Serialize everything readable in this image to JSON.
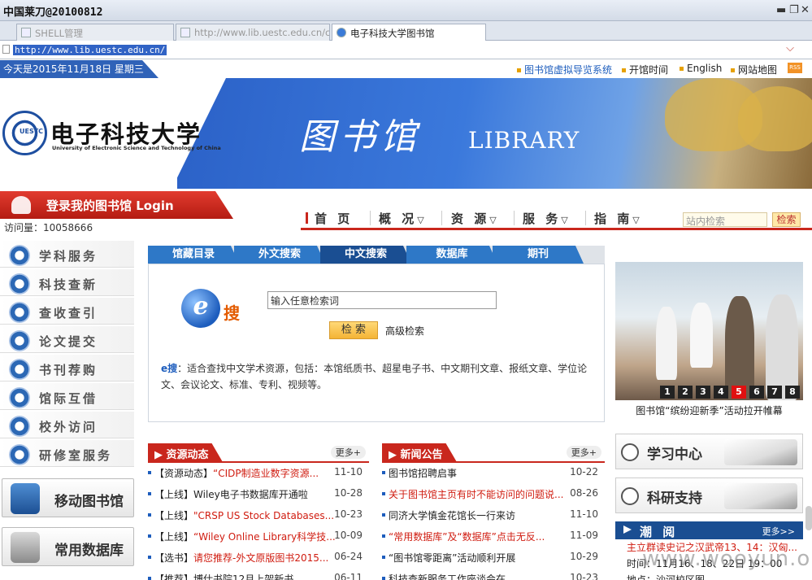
{
  "window": {
    "title": "中国莱刀@20100812",
    "min": "▬",
    "restore": "❐",
    "close": "✕"
  },
  "tabs": [
    {
      "label": "SHELL管理"
    },
    {
      "label": "http://www.lib.uestc.edu.cn/css..."
    },
    {
      "label": "电子科技大学图书馆"
    }
  ],
  "address": {
    "url": "http://www.lib.uestc.edu.cn/"
  },
  "top": {
    "date": "今天是2015年11月18日 星期三",
    "links": [
      "图书馆虚拟导览系统",
      "开馆时间",
      "English",
      "网站地图"
    ],
    "rss": "RSS"
  },
  "banner": {
    "uni_cn": "电子科技大学",
    "uni_en": "University of Electronic Science and Technology of China",
    "seal": "UESTC",
    "lib_cn": "图书馆",
    "lib_en": "LIBRARY"
  },
  "login": {
    "label": "登录我的图书馆    Login",
    "visits": "访问量：10058666"
  },
  "nav": {
    "items": [
      "首 页",
      "概 况",
      "资 源",
      "服 务",
      "指 南"
    ],
    "search_placeholder": "站内检索",
    "search_btn": "检索"
  },
  "sidebar": {
    "items": [
      "学科服务",
      "科技查新",
      "查收查引",
      "论文提交",
      "书刊荐购",
      "馆际互借",
      "校外访问",
      "研修室服务"
    ],
    "big": [
      "移动图书馆",
      "常用数据库"
    ]
  },
  "search": {
    "tabs": [
      "馆藏目录",
      "外文搜索",
      "中文搜索",
      "数据库",
      "期刊"
    ],
    "active": 2,
    "e": "e",
    "esou": "搜",
    "input": "输入任意检索词",
    "btn": "检 索",
    "adv": "高级检索",
    "desc_lead": "e搜",
    "desc": "：适合查找中文学术资源，包括：本馆纸质书、超星电子书、中文期刊文章、报纸文章、学位论文、会议论文、标准、专利、视频等。"
  },
  "news_res": {
    "title": "资源动态",
    "more": "更多+",
    "rows": [
      {
        "pre": "【资源动态】",
        "title": "“CIDP制造业数字资源...",
        "date": "11-10",
        "red": true
      },
      {
        "pre": "【上线】",
        "title": "Wiley电子书数据库开通啦",
        "date": "10-28",
        "red": false
      },
      {
        "pre": "【上线】",
        "title": "\"CRSP US Stock Databases...",
        "date": "10-23",
        "red": true
      },
      {
        "pre": "【上线】",
        "title": "“Wiley Online Library科学技...",
        "date": "10-09",
        "red": true
      },
      {
        "pre": "【选书】",
        "title": "请您推荐-外文原版图书2015...",
        "date": "06-24",
        "red": true
      },
      {
        "pre": "【推荐】",
        "title": "博仕书院12月上架新书...",
        "date": "06-11",
        "red": false
      }
    ]
  },
  "news_ann": {
    "title": "新闻公告",
    "more": "更多+",
    "rows": [
      {
        "title": "图书馆招聘启事",
        "date": "10-22",
        "red": false
      },
      {
        "title": "关于图书馆主页有时不能访问的问题说...",
        "date": "08-26",
        "red": true
      },
      {
        "title": "同济大学慎金花馆长一行来访",
        "date": "11-10",
        "red": false
      },
      {
        "title": "“常用数据库”及“数据库”点击无反...",
        "date": "11-09",
        "red": true
      },
      {
        "title": "“图书馆零距离”活动顺利开展",
        "date": "10-29",
        "red": false
      },
      {
        "title": "科技查新服务工作座谈会在...",
        "date": "10-23",
        "red": false
      }
    ]
  },
  "carousel": {
    "pages": [
      "1",
      "2",
      "3",
      "4",
      "5",
      "6",
      "7",
      "8"
    ],
    "active": 4,
    "caption": "图书馆“缤纷迎新季”活动拉开帷幕"
  },
  "right": {
    "study": "学习中心",
    "research": "科研支持",
    "chao": "潮 阅",
    "chao_more": "更多>>",
    "chao_lines": [
      "主立群读史记之汉武帝13、14：汉匈...",
      "时间：11月16、18、22日 19：00",
      "地点：沙河校区图..."
    ]
  },
  "watermark": "www.wooyun.org"
}
